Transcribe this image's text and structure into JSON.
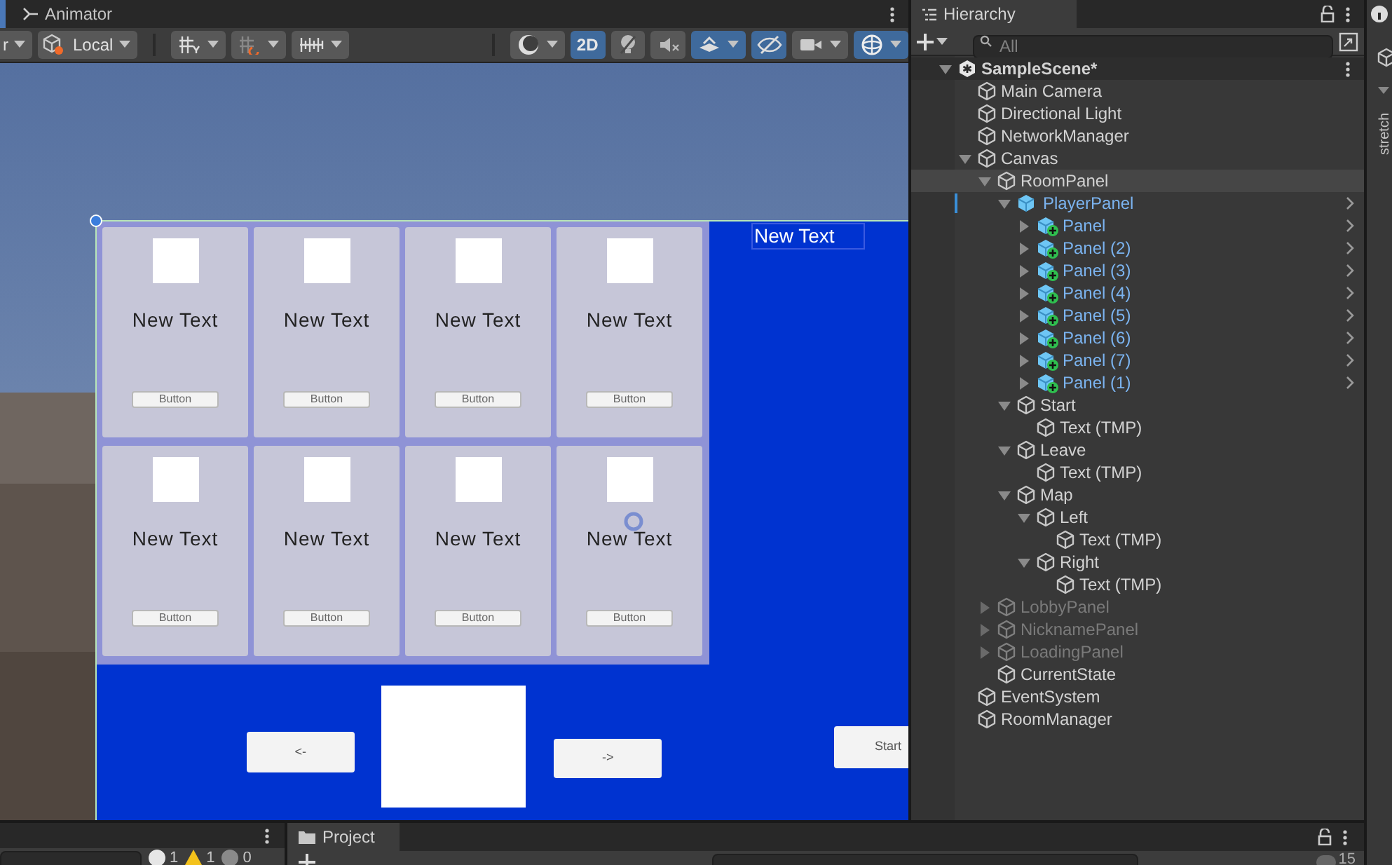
{
  "scene_view": {
    "tab": "Animator",
    "toolbar": [
      {
        "kind": "dropdown",
        "label": "r"
      },
      {
        "kind": "dropdown",
        "label": "Local"
      },
      {
        "kind": "sep"
      },
      {
        "kind": "icon-dropdown",
        "on": false
      },
      {
        "kind": "icon-dropdown",
        "on": false
      },
      {
        "kind": "icon-dropdown",
        "on": false
      },
      {
        "kind": "sep"
      },
      {
        "kind": "icon-dropdown",
        "on": false
      },
      {
        "kind": "text",
        "label": "2D",
        "on": true
      },
      {
        "kind": "icon",
        "on": false
      },
      {
        "kind": "icon",
        "on": false
      },
      {
        "kind": "icon-dropdown",
        "on": true
      },
      {
        "kind": "icon",
        "on": true
      },
      {
        "kind": "icon-dropdown",
        "on": false
      },
      {
        "kind": "icon-dropdown",
        "on": true
      }
    ],
    "cards": [
      {
        "label": "New Text",
        "button": "Button"
      },
      {
        "label": "New Text",
        "button": "Button"
      },
      {
        "label": "New Text",
        "button": "Button"
      },
      {
        "label": "New Text",
        "button": "Button"
      },
      {
        "label": "New Text",
        "button": "Button"
      },
      {
        "label": "New Text",
        "button": "Button"
      },
      {
        "label": "New Text",
        "button": "Button"
      },
      {
        "label": "New Text",
        "button": "Button"
      }
    ],
    "corner_text": "New Text",
    "prev_button": "<-",
    "next_button": "->",
    "start_button": "Start"
  },
  "hierarchy": {
    "tab": "Hierarchy",
    "search": {
      "placeholder": "All"
    },
    "tree": [
      {
        "name": "SampleScene*",
        "kind": "scene",
        "expanded": true,
        "disabled": false,
        "selected": false,
        "children": [
          {
            "name": "Main Camera",
            "kind": "object",
            "disabled": false,
            "selected": false
          },
          {
            "name": "Directional Light",
            "kind": "object",
            "disabled": false,
            "selected": false
          },
          {
            "name": "NetworkManager",
            "kind": "object",
            "disabled": false,
            "selected": false
          },
          {
            "name": "Canvas",
            "kind": "object",
            "expanded": true,
            "disabled": false,
            "selected": false,
            "children": [
              {
                "name": "RoomPanel",
                "kind": "object",
                "expanded": true,
                "disabled": false,
                "selected": true,
                "children": [
                  {
                    "name": "PlayerPanel",
                    "kind": "prefab",
                    "expanded": true,
                    "disabled": false,
                    "selected": false,
                    "children": [
                      {
                        "name": "Panel",
                        "kind": "prefab-added",
                        "expanded": false,
                        "disabled": false,
                        "selected": false
                      },
                      {
                        "name": "Panel (2)",
                        "kind": "prefab-added",
                        "expanded": false,
                        "disabled": false,
                        "selected": false
                      },
                      {
                        "name": "Panel (3)",
                        "kind": "prefab-added",
                        "expanded": false,
                        "disabled": false,
                        "selected": false
                      },
                      {
                        "name": "Panel (4)",
                        "kind": "prefab-added",
                        "expanded": false,
                        "disabled": false,
                        "selected": false
                      },
                      {
                        "name": "Panel (5)",
                        "kind": "prefab-added",
                        "expanded": false,
                        "disabled": false,
                        "selected": false
                      },
                      {
                        "name": "Panel (6)",
                        "kind": "prefab-added",
                        "expanded": false,
                        "disabled": false,
                        "selected": false
                      },
                      {
                        "name": "Panel (7)",
                        "kind": "prefab-added",
                        "expanded": false,
                        "disabled": false,
                        "selected": false
                      },
                      {
                        "name": "Panel (1)",
                        "kind": "prefab-added",
                        "expanded": false,
                        "disabled": false,
                        "selected": false
                      }
                    ]
                  },
                  {
                    "name": "Start",
                    "kind": "object",
                    "expanded": true,
                    "disabled": false,
                    "selected": false,
                    "children": [
                      {
                        "name": "Text (TMP)",
                        "kind": "object",
                        "disabled": false,
                        "selected": false
                      }
                    ]
                  },
                  {
                    "name": "Leave",
                    "kind": "object",
                    "expanded": true,
                    "disabled": false,
                    "selected": false,
                    "children": [
                      {
                        "name": "Text (TMP)",
                        "kind": "object",
                        "disabled": false,
                        "selected": false
                      }
                    ]
                  },
                  {
                    "name": "Map",
                    "kind": "object",
                    "expanded": true,
                    "disabled": false,
                    "selected": false,
                    "children": [
                      {
                        "name": "Left",
                        "kind": "object",
                        "expanded": true,
                        "disabled": false,
                        "selected": false,
                        "children": [
                          {
                            "name": "Text (TMP)",
                            "kind": "object",
                            "disabled": false,
                            "selected": false
                          }
                        ]
                      },
                      {
                        "name": "Right",
                        "kind": "object",
                        "expanded": true,
                        "disabled": false,
                        "selected": false,
                        "children": [
                          {
                            "name": "Text (TMP)",
                            "kind": "object",
                            "disabled": false,
                            "selected": false
                          }
                        ]
                      }
                    ]
                  }
                ]
              },
              {
                "name": "LobbyPanel",
                "kind": "object",
                "expanded": false,
                "disabled": true,
                "selected": false
              },
              {
                "name": "NicknamePanel",
                "kind": "object",
                "expanded": false,
                "disabled": true,
                "selected": false
              },
              {
                "name": "LoadingPanel",
                "kind": "object",
                "expanded": false,
                "disabled": true,
                "selected": false
              },
              {
                "name": "CurrentState",
                "kind": "object",
                "disabled": false,
                "selected": false
              }
            ]
          },
          {
            "name": "EventSystem",
            "kind": "object",
            "disabled": false,
            "selected": false
          },
          {
            "name": "RoomManager",
            "kind": "object",
            "disabled": false,
            "selected": false
          }
        ]
      }
    ]
  },
  "inspector": {
    "label": "stretch"
  },
  "console": {
    "counts": [
      {
        "kind": "info",
        "count": "1"
      },
      {
        "kind": "warning",
        "count": "1"
      },
      {
        "kind": "error",
        "count": "0"
      }
    ]
  },
  "project": {
    "tab": "Project",
    "visible_count": "15"
  }
}
